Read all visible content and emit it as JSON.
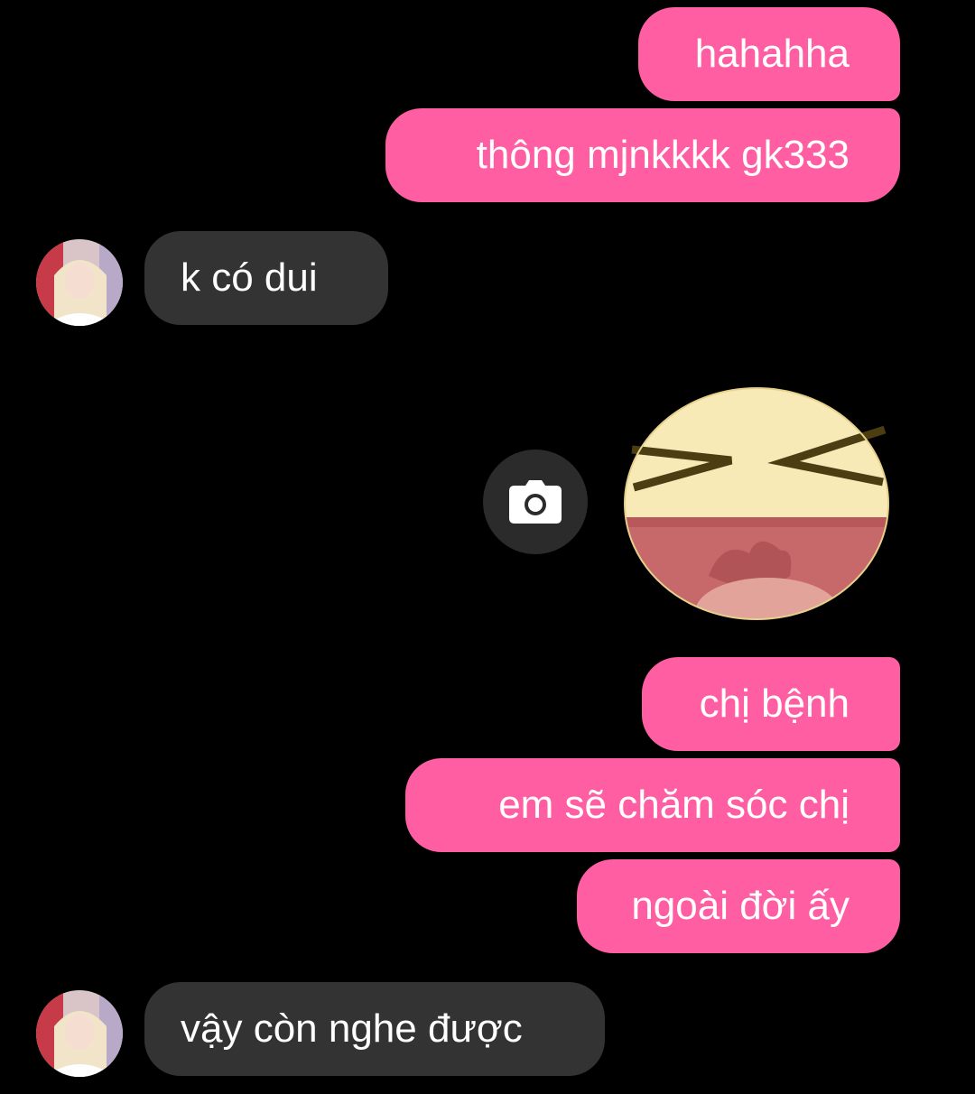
{
  "messages": [
    {
      "side": "sent",
      "text": "hahahha"
    },
    {
      "side": "sent",
      "text": "thông mjnkkkk gk333"
    },
    {
      "side": "received",
      "text": "k có dui"
    },
    {
      "side": "sent",
      "type": "sticker",
      "sticker": "laughing-face-sticker"
    },
    {
      "side": "sent",
      "text": "chị bệnh"
    },
    {
      "side": "sent",
      "text": "em sẽ chăm sóc chị"
    },
    {
      "side": "sent",
      "text": "ngoài đời ấy"
    },
    {
      "side": "received",
      "text": "vậy còn nghe được"
    }
  ],
  "icons": {
    "camera": "camera-icon",
    "avatar": "contact-avatar"
  },
  "colors": {
    "background": "#000000",
    "sent_bubble": "#ff5fa2",
    "received_bubble": "#333333",
    "text": "#ffffff",
    "camera_button": "#2b2b2b"
  }
}
